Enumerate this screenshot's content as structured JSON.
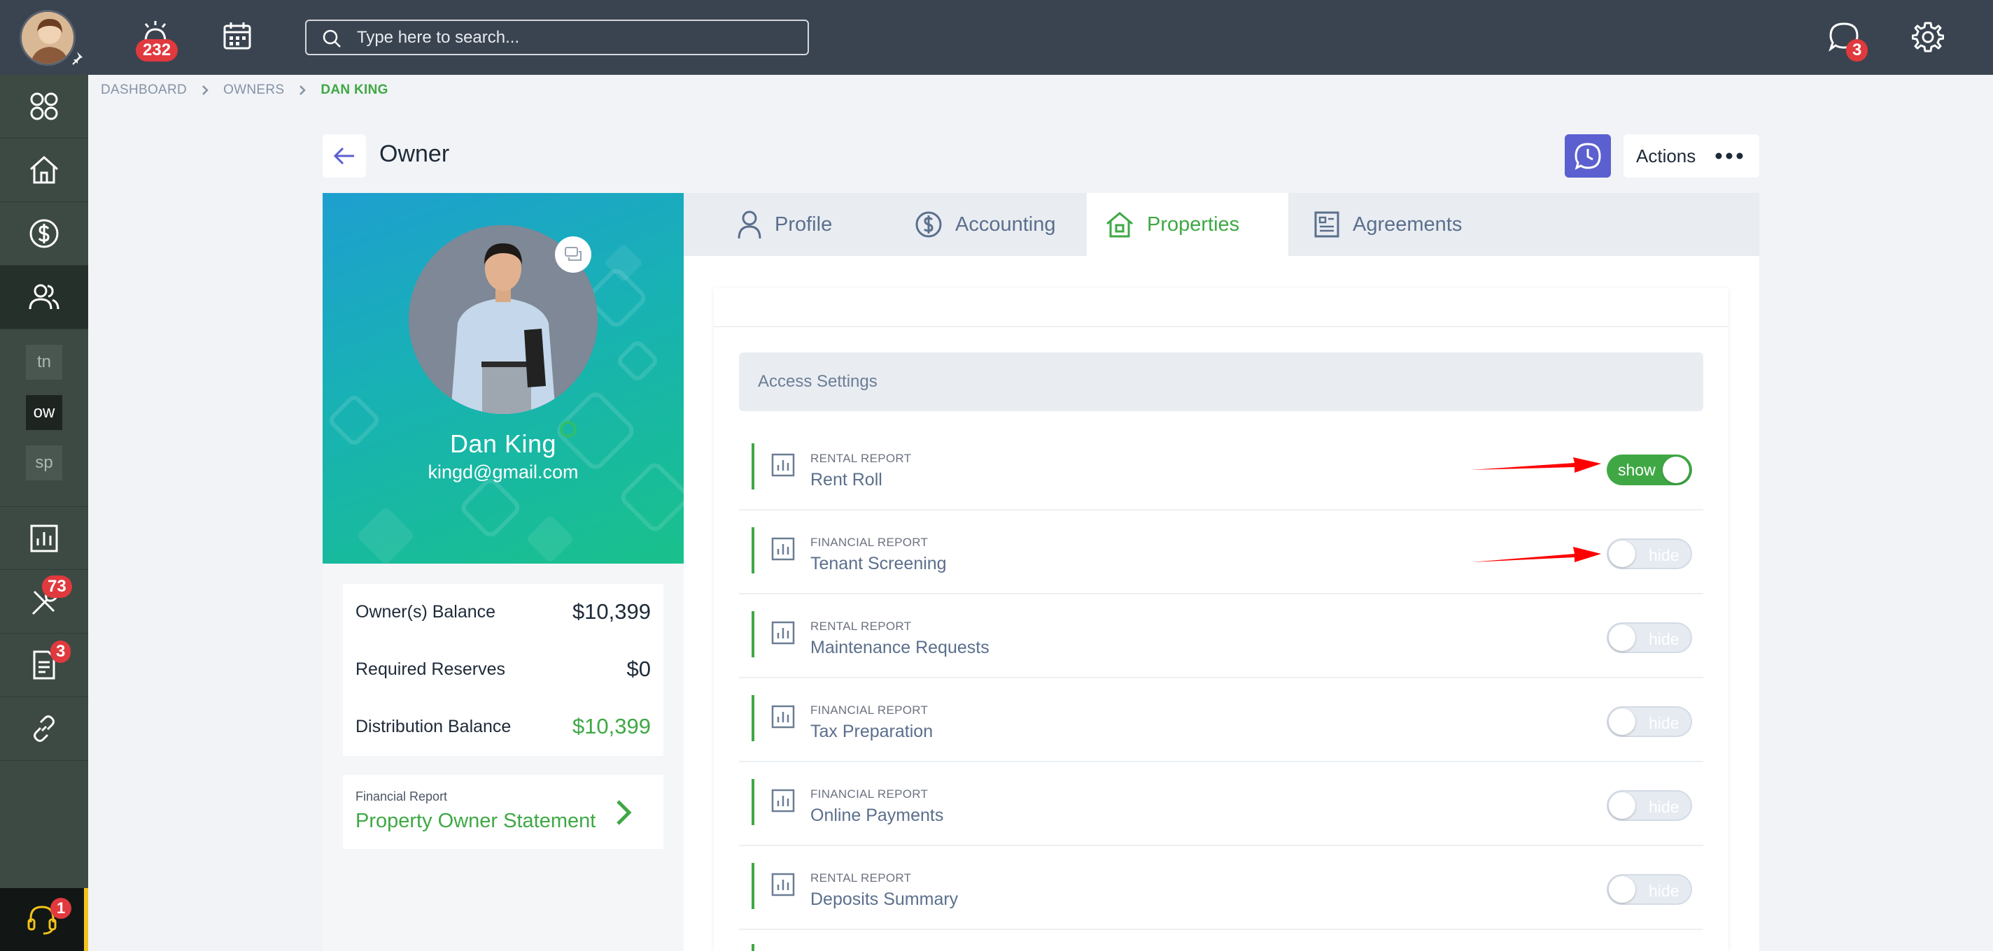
{
  "topbar": {
    "alerts_count": "232",
    "messages_count": "3",
    "search_placeholder": "Type here to search..."
  },
  "sidebar": {
    "chips": [
      "tn",
      "ow",
      "sp"
    ],
    "maintenance_count": "73",
    "documents_count": "3",
    "support_count": "1"
  },
  "breadcrumb": [
    "DASHBOARD",
    "OWNERS",
    "DAN KING"
  ],
  "header": {
    "title": "Owner",
    "actions_label": "Actions"
  },
  "owner": {
    "name": "Dan King",
    "email": "kingd@gmail.com",
    "balances": [
      {
        "label": "Owner(s) Balance",
        "value": "$10,399"
      },
      {
        "label": "Required Reserves",
        "value": "$0"
      },
      {
        "label": "Distribution Balance",
        "value": "$10,399"
      }
    ],
    "report_caption": "Financial Report",
    "report_title": "Property Owner Statement"
  },
  "tabs": [
    {
      "label": "Profile",
      "icon": "person-icon"
    },
    {
      "label": "Accounting",
      "icon": "dollar-icon"
    },
    {
      "label": "Properties",
      "icon": "house-icon",
      "active": true
    },
    {
      "label": "Agreements",
      "icon": "document-icon"
    }
  ],
  "access_settings": {
    "title": "Access Settings",
    "reports": [
      {
        "category": "RENTAL REPORT",
        "name": "Rent Roll",
        "state": "show"
      },
      {
        "category": "FINANCIAL REPORT",
        "name": "Tenant Screening",
        "state": "hide"
      },
      {
        "category": "RENTAL REPORT",
        "name": "Maintenance Requests",
        "state": "hide"
      },
      {
        "category": "FINANCIAL REPORT",
        "name": "Tax Preparation",
        "state": "hide"
      },
      {
        "category": "FINANCIAL REPORT",
        "name": "Online Payments",
        "state": "hide"
      },
      {
        "category": "RENTAL REPORT",
        "name": "Deposits Summary",
        "state": "hide"
      }
    ]
  },
  "colors": {
    "accent_green": "#3fa845",
    "topbar": "#3a4450",
    "sidebar": "#3d4a43",
    "badge_red": "#e0393e",
    "history_button": "#5b5fcf",
    "annotation_arrow": "#ff0000"
  }
}
